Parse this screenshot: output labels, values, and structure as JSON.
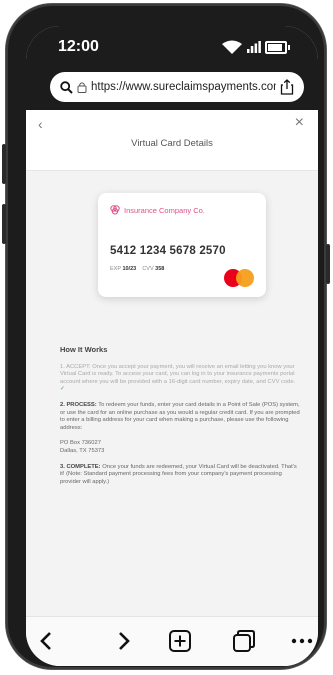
{
  "status": {
    "time": "12:00"
  },
  "browser": {
    "url": "https://www.sureclaimspayments.com"
  },
  "page": {
    "title": "Virtual Card Details"
  },
  "card": {
    "brand": "Insurance Company Co.",
    "number": "5412 1234 5678 2570",
    "exp_label": "EXP",
    "exp": "10/23",
    "cvv_label": "CVV",
    "cvv": "358",
    "network": "mastercard"
  },
  "how": {
    "heading": "How It Works",
    "accept_label": "1. ACCEPT:",
    "accept_text": "Once you accept your payment, you will receive an email letting you know your Virtual Card is ready. To access your card, you can log in to your insurance payments portal account where you will be provided with a 16-digit card number, expiry date, and CVV code.",
    "process_label": "2. PROCESS:",
    "process_text": "To redeem your funds, enter your card details in a Point of Sale (POS) system, or use the card for an online purchase as you would a regular credit card. If you are prompted to enter a billing address for your card when making a purchase, please use the following address:",
    "address_line1": "PO Box 736027",
    "address_line2": "Dallas, TX 75373",
    "complete_label": "3. COMPLETE:",
    "complete_text": "Once your funds are redeemed, your Virtual Card will be deactivated. That's it! (Note: Standard payment processing fees from your company's payment processing provider will apply.)"
  },
  "icons": {
    "back": "chevron-left-icon",
    "forward": "chevron-right-icon",
    "new_tab": "plus-square-icon",
    "tabs": "tabs-icon",
    "more": "more-icon"
  },
  "colors": {
    "brand_pink": "#e0508a",
    "check_green": "#4caf50"
  }
}
